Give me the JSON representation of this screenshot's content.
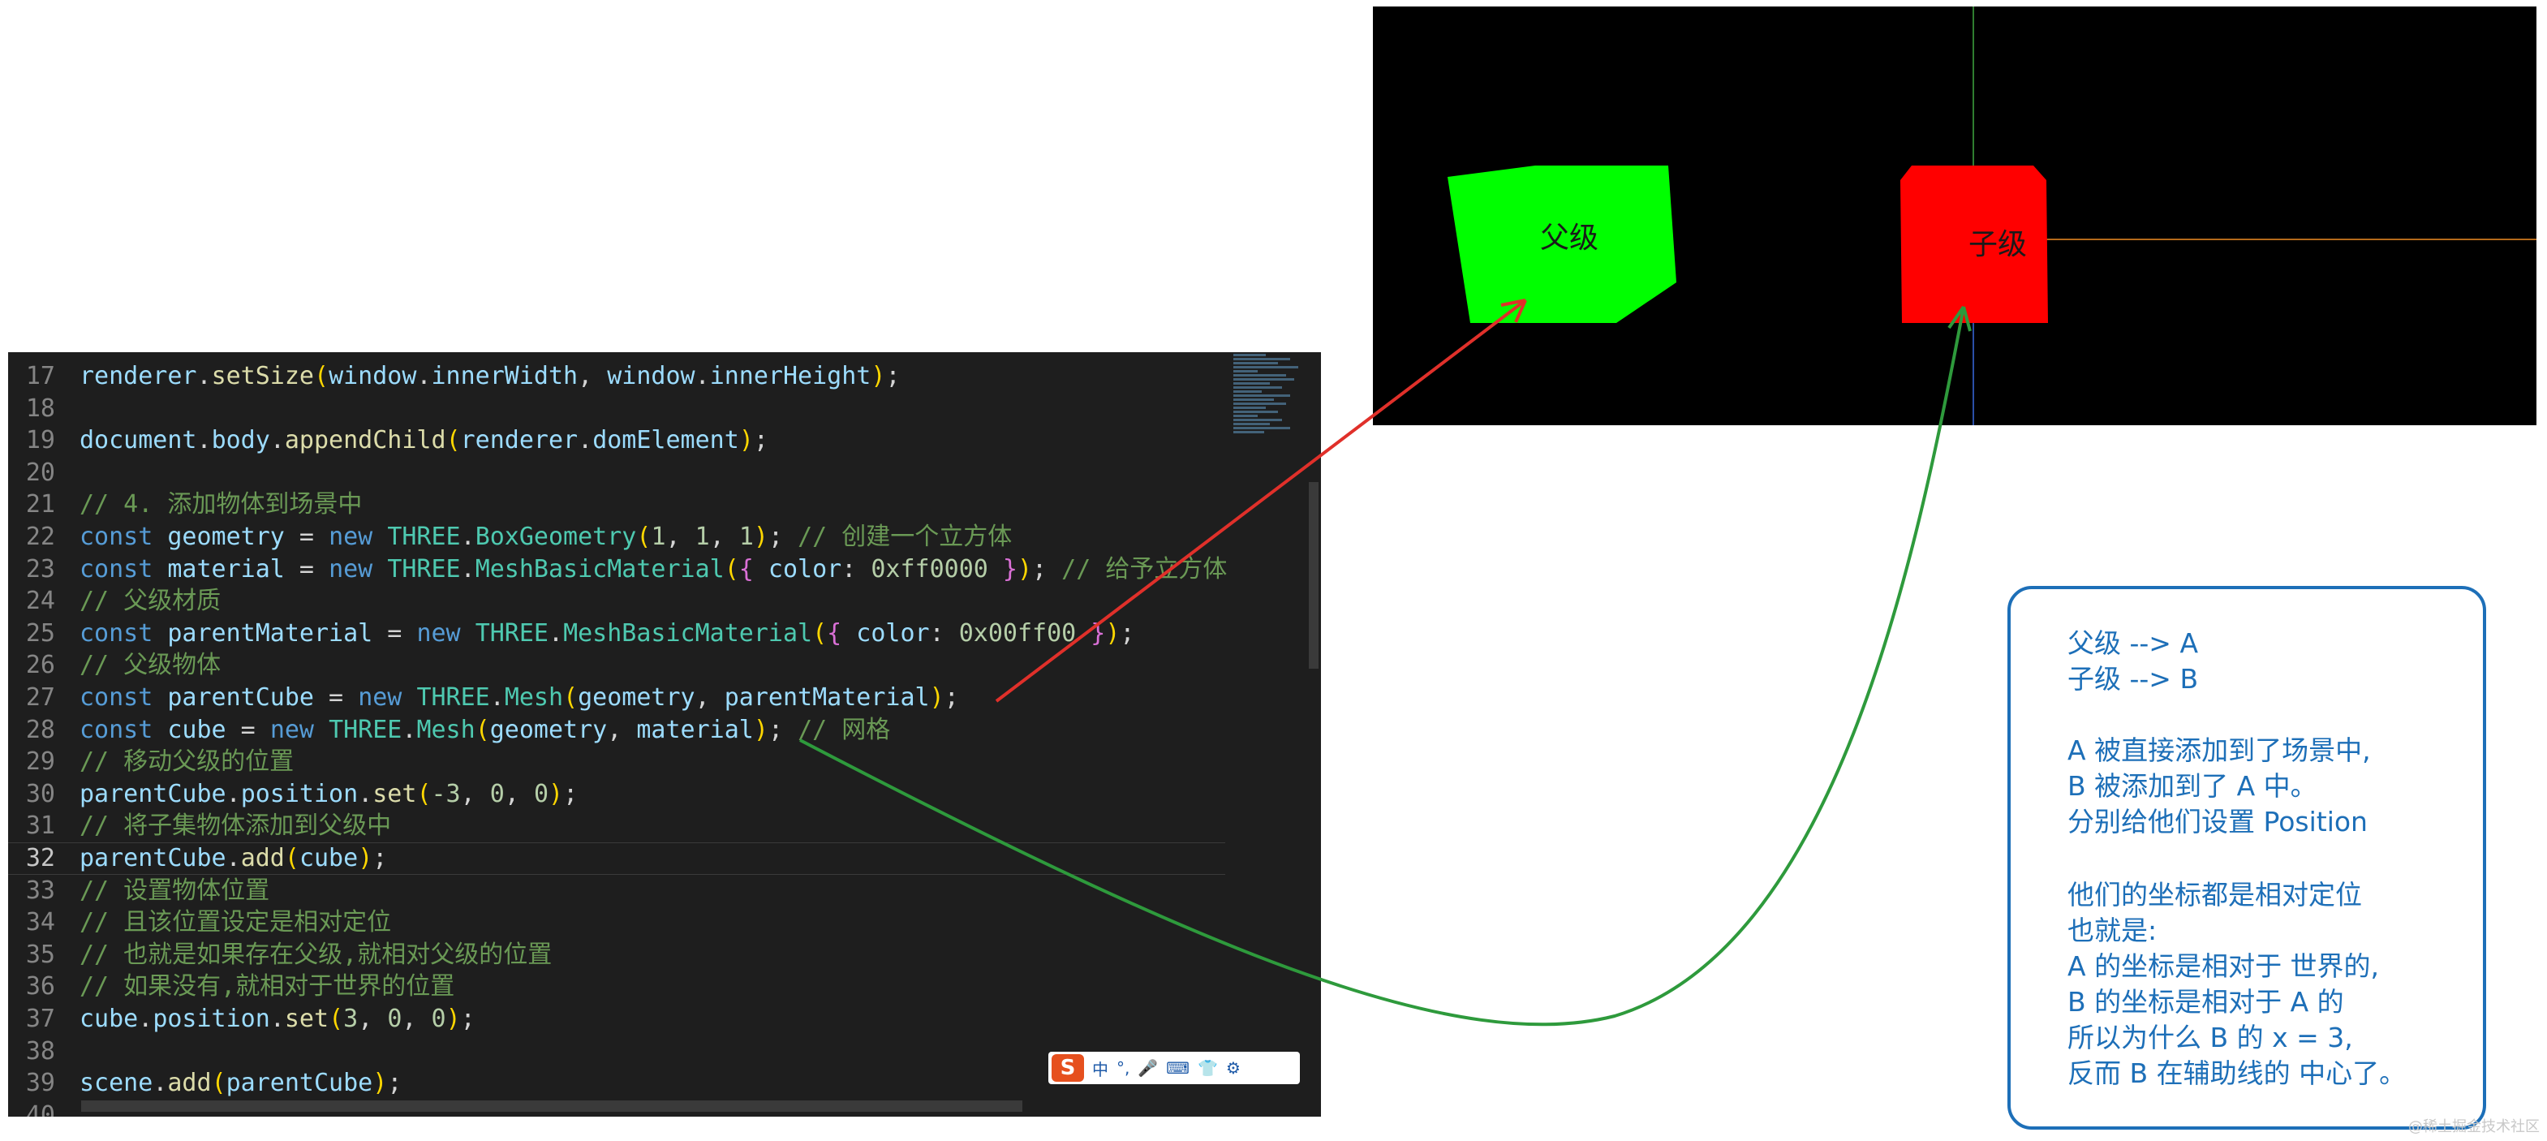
{
  "editor": {
    "lines": [
      {
        "n": "17",
        "tokens": [
          [
            "renderer",
            "var"
          ],
          [
            ".",
            "plain"
          ],
          [
            "setSize",
            "fn"
          ],
          [
            "(",
            "p1"
          ],
          [
            "window",
            "var"
          ],
          [
            ".",
            "plain"
          ],
          [
            "innerWidth",
            "var"
          ],
          [
            ", ",
            "plain"
          ],
          [
            "window",
            "var"
          ],
          [
            ".",
            "plain"
          ],
          [
            "innerHeight",
            "var"
          ],
          [
            ")",
            "p1"
          ],
          [
            ";",
            "plain"
          ]
        ]
      },
      {
        "n": "18",
        "tokens": []
      },
      {
        "n": "19",
        "tokens": [
          [
            "document",
            "var"
          ],
          [
            ".",
            "plain"
          ],
          [
            "body",
            "var"
          ],
          [
            ".",
            "plain"
          ],
          [
            "appendChild",
            "fn"
          ],
          [
            "(",
            "p1"
          ],
          [
            "renderer",
            "var"
          ],
          [
            ".",
            "plain"
          ],
          [
            "domElement",
            "var"
          ],
          [
            ")",
            "p1"
          ],
          [
            ";",
            "plain"
          ]
        ]
      },
      {
        "n": "20",
        "tokens": []
      },
      {
        "n": "21",
        "tokens": [
          [
            "// 4. 添加物体到场景中",
            "com"
          ]
        ]
      },
      {
        "n": "22",
        "tokens": [
          [
            "const ",
            "kw"
          ],
          [
            "geometry",
            "var"
          ],
          [
            " = ",
            "plain"
          ],
          [
            "new ",
            "kw"
          ],
          [
            "THREE",
            "cls"
          ],
          [
            ".",
            "plain"
          ],
          [
            "BoxGeometry",
            "cls"
          ],
          [
            "(",
            "p1"
          ],
          [
            "1",
            "num"
          ],
          [
            ", ",
            "plain"
          ],
          [
            "1",
            "num"
          ],
          [
            ", ",
            "plain"
          ],
          [
            "1",
            "num"
          ],
          [
            ")",
            "p1"
          ],
          [
            "; ",
            "plain"
          ],
          [
            "// 创建一个立方体",
            "com"
          ]
        ]
      },
      {
        "n": "23",
        "tokens": [
          [
            "const ",
            "kw"
          ],
          [
            "material",
            "var"
          ],
          [
            " = ",
            "plain"
          ],
          [
            "new ",
            "kw"
          ],
          [
            "THREE",
            "cls"
          ],
          [
            ".",
            "plain"
          ],
          [
            "MeshBasicMaterial",
            "cls"
          ],
          [
            "(",
            "p1"
          ],
          [
            "{",
            "p2"
          ],
          [
            " color",
            "var"
          ],
          [
            ": ",
            "plain"
          ],
          [
            "0xff0000",
            "num"
          ],
          [
            " }",
            "p2"
          ],
          [
            ")",
            "p1"
          ],
          [
            "; ",
            "plain"
          ],
          [
            "// 给予立方体",
            "com"
          ]
        ]
      },
      {
        "n": "24",
        "tokens": [
          [
            "// 父级材质",
            "com"
          ]
        ]
      },
      {
        "n": "25",
        "tokens": [
          [
            "const ",
            "kw"
          ],
          [
            "parentMaterial",
            "var"
          ],
          [
            " = ",
            "plain"
          ],
          [
            "new ",
            "kw"
          ],
          [
            "THREE",
            "cls"
          ],
          [
            ".",
            "plain"
          ],
          [
            "MeshBasicMaterial",
            "cls"
          ],
          [
            "(",
            "p1"
          ],
          [
            "{",
            "p2"
          ],
          [
            " color",
            "var"
          ],
          [
            ": ",
            "plain"
          ],
          [
            "0x00ff00",
            "num"
          ],
          [
            " }",
            "p2"
          ],
          [
            ")",
            "p1"
          ],
          [
            ";",
            "plain"
          ]
        ]
      },
      {
        "n": "26",
        "tokens": [
          [
            "// 父级物体",
            "com"
          ]
        ]
      },
      {
        "n": "27",
        "tokens": [
          [
            "const ",
            "kw"
          ],
          [
            "parentCube",
            "var"
          ],
          [
            " = ",
            "plain"
          ],
          [
            "new ",
            "kw"
          ],
          [
            "THREE",
            "cls"
          ],
          [
            ".",
            "plain"
          ],
          [
            "Mesh",
            "cls"
          ],
          [
            "(",
            "p1"
          ],
          [
            "geometry",
            "var"
          ],
          [
            ", ",
            "plain"
          ],
          [
            "parentMaterial",
            "var"
          ],
          [
            ")",
            "p1"
          ],
          [
            ";",
            "plain"
          ]
        ]
      },
      {
        "n": "28",
        "tokens": [
          [
            "const ",
            "kw"
          ],
          [
            "cube",
            "var"
          ],
          [
            " = ",
            "plain"
          ],
          [
            "new ",
            "kw"
          ],
          [
            "THREE",
            "cls"
          ],
          [
            ".",
            "plain"
          ],
          [
            "Mesh",
            "cls"
          ],
          [
            "(",
            "p1"
          ],
          [
            "geometry",
            "var"
          ],
          [
            ", ",
            "plain"
          ],
          [
            "material",
            "var"
          ],
          [
            ")",
            "p1"
          ],
          [
            "; ",
            "plain"
          ],
          [
            "// 网格",
            "com"
          ]
        ]
      },
      {
        "n": "29",
        "tokens": [
          [
            "// 移动父级的位置",
            "com"
          ]
        ]
      },
      {
        "n": "30",
        "tokens": [
          [
            "parentCube",
            "var"
          ],
          [
            ".",
            "plain"
          ],
          [
            "position",
            "var"
          ],
          [
            ".",
            "plain"
          ],
          [
            "set",
            "fn"
          ],
          [
            "(",
            "p1"
          ],
          [
            "-3",
            "num"
          ],
          [
            ", ",
            "plain"
          ],
          [
            "0",
            "num"
          ],
          [
            ", ",
            "plain"
          ],
          [
            "0",
            "num"
          ],
          [
            ")",
            "p1"
          ],
          [
            ";",
            "plain"
          ]
        ]
      },
      {
        "n": "31",
        "tokens": [
          [
            "// 将子集物体添加到父级中",
            "com"
          ]
        ]
      },
      {
        "n": "32",
        "active": true,
        "tokens": [
          [
            "parentCube",
            "var"
          ],
          [
            ".",
            "plain"
          ],
          [
            "add",
            "fn"
          ],
          [
            "(",
            "p1"
          ],
          [
            "cube",
            "var"
          ],
          [
            ")",
            "p1"
          ],
          [
            ";",
            "plain"
          ]
        ]
      },
      {
        "n": "33",
        "tokens": [
          [
            "// 设置物体位置",
            "com"
          ]
        ]
      },
      {
        "n": "34",
        "tokens": [
          [
            "// 且该位置设定是相对定位",
            "com"
          ]
        ]
      },
      {
        "n": "35",
        "tokens": [
          [
            "// 也就是如果存在父级,就相对父级的位置",
            "com"
          ]
        ]
      },
      {
        "n": "36",
        "tokens": [
          [
            "// 如果没有,就相对于世界的位置",
            "com"
          ]
        ]
      },
      {
        "n": "37",
        "tokens": [
          [
            "cube",
            "var"
          ],
          [
            ".",
            "plain"
          ],
          [
            "position",
            "var"
          ],
          [
            ".",
            "plain"
          ],
          [
            "set",
            "fn"
          ],
          [
            "(",
            "p1"
          ],
          [
            "3",
            "num"
          ],
          [
            ", ",
            "plain"
          ],
          [
            "0",
            "num"
          ],
          [
            ", ",
            "plain"
          ],
          [
            "0",
            "num"
          ],
          [
            ")",
            "p1"
          ],
          [
            ";",
            "plain"
          ]
        ]
      },
      {
        "n": "38",
        "tokens": []
      },
      {
        "n": "39",
        "tokens": [
          [
            "scene",
            "var"
          ],
          [
            ".",
            "plain"
          ],
          [
            "add",
            "fn"
          ],
          [
            "(",
            "p1"
          ],
          [
            "parentCube",
            "var"
          ],
          [
            ")",
            "p1"
          ],
          [
            ";",
            "plain"
          ]
        ]
      },
      {
        "n": "40",
        "tokens": []
      }
    ],
    "ime": {
      "logo": "S",
      "lang": "中",
      "items": [
        "°,",
        "🎤",
        "⌨",
        "👕",
        "⚙"
      ]
    }
  },
  "render": {
    "parent_label": "父级",
    "child_label": "子级",
    "colors": {
      "parent": "#00ff00",
      "child": "#ff0000",
      "background": "#000000",
      "axis_y": "#2f7d2f",
      "axis_x": "#b36a1a",
      "axis_z": "#2a4fa8"
    }
  },
  "note": {
    "lines": [
      "父级 --> A",
      "子级 --> B",
      "",
      "A 被直接添加到了场景中,",
      "B 被添加到了 A 中。",
      "分别给他们设置 Position",
      "",
      "他们的坐标都是相对定位",
      "也就是:",
      "A 的坐标是相对于 世界的,",
      "B 的坐标是相对于 A 的",
      "所以为什么 B 的 x = 3,",
      "反而 B 在辅助线的 中心了。"
    ]
  },
  "annotations": {
    "arrow_red": "#e0302a",
    "arrow_green": "#2e9a3c",
    "note_color": "#1d6fb8"
  },
  "watermark": "@稀土掘金技术社区"
}
